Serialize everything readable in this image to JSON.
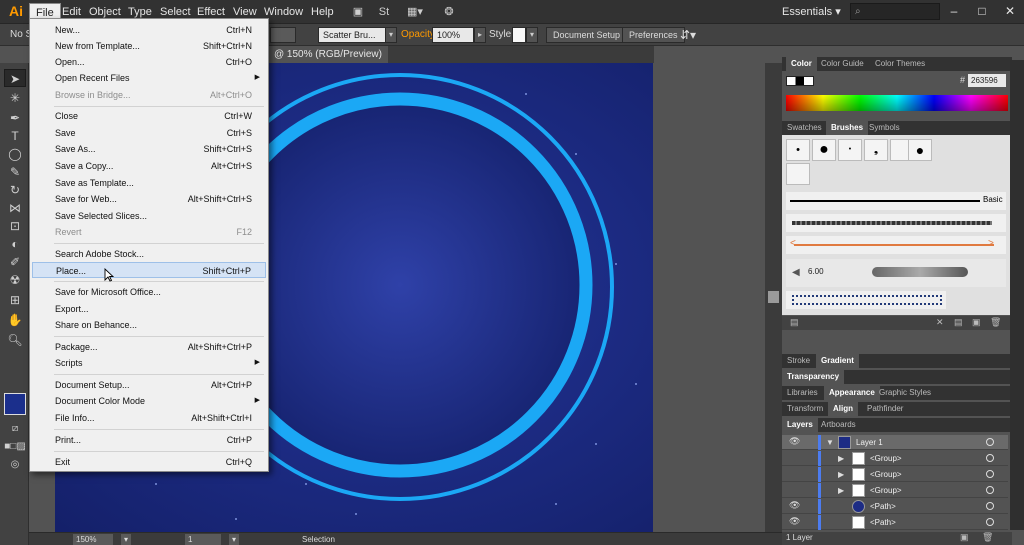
{
  "app": {
    "logo": "Ai"
  },
  "menubar": {
    "items": [
      "File",
      "Edit",
      "Object",
      "Type",
      "Select",
      "Effect",
      "View",
      "Window",
      "Help"
    ],
    "workspace": "Essentials",
    "search_placeholder": "",
    "window_buttons": [
      "–",
      "□",
      "✕"
    ]
  },
  "controlbar": {
    "selection": "No Se",
    "brush": "Scatter Bru...",
    "opacity_label": "Opacity:",
    "opacity_value": "100%",
    "style_label": "Style:",
    "document_setup": "Document Setup",
    "preferences": "Preferences"
  },
  "document_tab": {
    "title": "@ 150% (RGB/Preview)",
    "close": "✕"
  },
  "file_menu": {
    "items": [
      {
        "label": "New...",
        "shortcut": "Ctrl+N"
      },
      {
        "label": "New from Template...",
        "shortcut": "Shift+Ctrl+N"
      },
      {
        "label": "Open...",
        "shortcut": "Ctrl+O"
      },
      {
        "label": "Open Recent Files",
        "shortcut": "",
        "submenu": true
      },
      {
        "label": "Browse in Bridge...",
        "shortcut": "Alt+Ctrl+O",
        "disabled": true
      },
      {
        "label": "Close",
        "shortcut": "Ctrl+W"
      },
      {
        "label": "Save",
        "shortcut": "Ctrl+S"
      },
      {
        "label": "Save As...",
        "shortcut": "Shift+Ctrl+S"
      },
      {
        "label": "Save a Copy...",
        "shortcut": "Alt+Ctrl+S"
      },
      {
        "label": "Save as Template...",
        "shortcut": ""
      },
      {
        "label": "Save for Web...",
        "shortcut": "Alt+Shift+Ctrl+S"
      },
      {
        "label": "Save Selected Slices...",
        "shortcut": ""
      },
      {
        "label": "Revert",
        "shortcut": "F12",
        "disabled": true
      },
      {
        "label": "Search Adobe Stock...",
        "shortcut": ""
      },
      {
        "label": "Place...",
        "shortcut": "Shift+Ctrl+P",
        "highlighted": true
      },
      {
        "label": "Save for Microsoft Office...",
        "shortcut": ""
      },
      {
        "label": "Export...",
        "shortcut": ""
      },
      {
        "label": "Share on Behance...",
        "shortcut": ""
      },
      {
        "label": "Package...",
        "shortcut": "Alt+Shift+Ctrl+P"
      },
      {
        "label": "Scripts",
        "shortcut": "",
        "submenu": true
      },
      {
        "label": "Document Setup...",
        "shortcut": "Alt+Ctrl+P"
      },
      {
        "label": "Document Color Mode",
        "shortcut": "",
        "submenu": true
      },
      {
        "label": "File Info...",
        "shortcut": "Alt+Shift+Ctrl+I"
      },
      {
        "label": "Print...",
        "shortcut": "Ctrl+P"
      },
      {
        "label": "Exit",
        "shortcut": "Ctrl+Q"
      }
    ]
  },
  "color_panel": {
    "tabs": [
      "Color",
      "Color Guide",
      "Color Themes"
    ],
    "hex_prefix": "#",
    "hex_value": "263596"
  },
  "brushes_panel": {
    "tabs": [
      "Swatches",
      "Brushes",
      "Symbols"
    ],
    "basic_label": "Basic",
    "size_label": "6.00"
  },
  "stroke_panel": {
    "tabs": [
      "Stroke",
      "Gradient"
    ]
  },
  "transparency_panel": {
    "tabs": [
      "Transparency"
    ]
  },
  "libraries_panel": {
    "tabs": [
      "Libraries",
      "Appearance",
      "Graphic Styles"
    ]
  },
  "transform_panel": {
    "tabs": [
      "Transform",
      "Align",
      "Pathfinder"
    ]
  },
  "layers_panel": {
    "tabs": [
      "Layers",
      "Artboards"
    ],
    "rows": [
      {
        "name": "Layer 1"
      },
      {
        "name": "<Group>"
      },
      {
        "name": "<Group>"
      },
      {
        "name": "<Group>"
      },
      {
        "name": "<Path>"
      },
      {
        "name": "<Path>"
      }
    ],
    "footer": "1 Layer"
  },
  "statusbar": {
    "zoom": "150%",
    "artboard": "1",
    "tool": "Selection"
  },
  "colors": {
    "artboard": "#1d2c85",
    "ring": "#1ba8f5",
    "accent": "#ff9a00"
  }
}
